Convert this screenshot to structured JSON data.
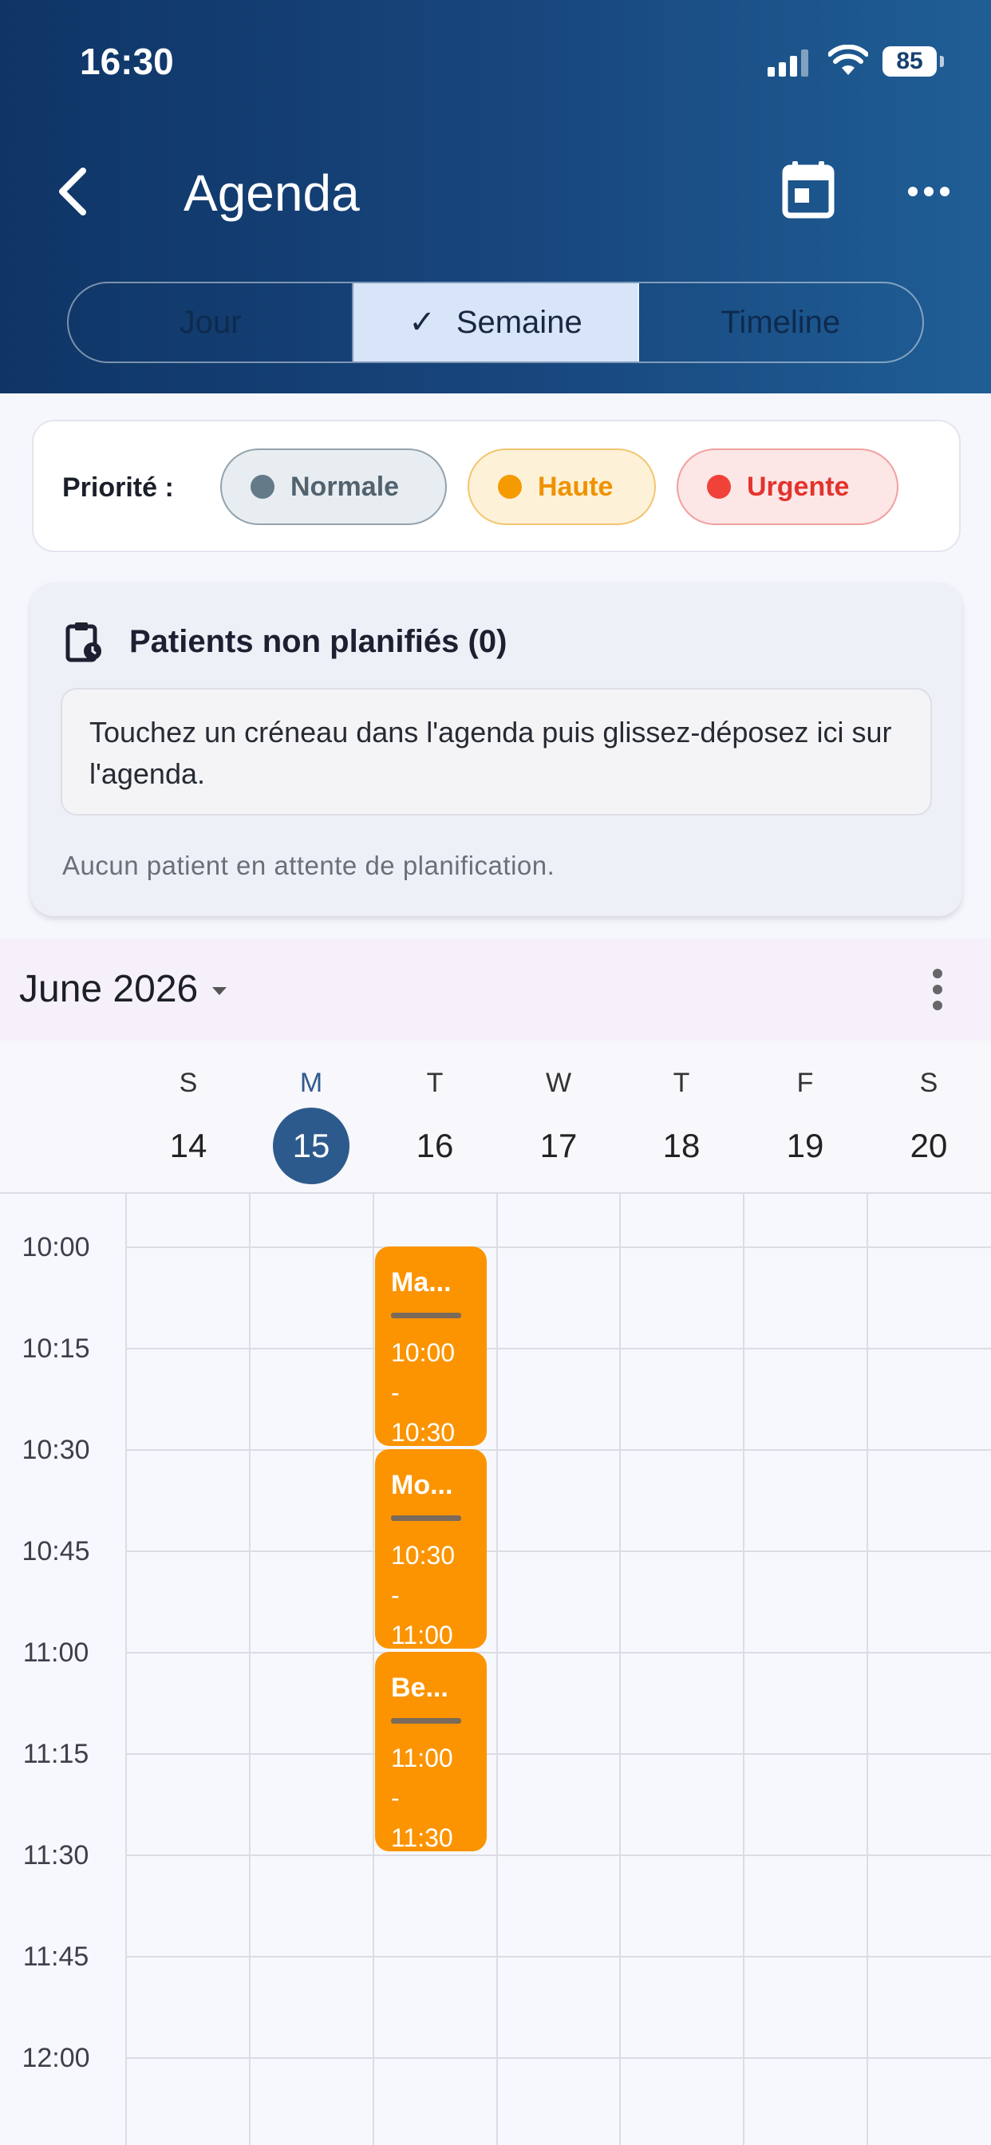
{
  "status_bar": {
    "time": "16:30",
    "battery": "85"
  },
  "header": {
    "title": "Agenda",
    "tabs": [
      {
        "label": "Jour",
        "active": false
      },
      {
        "label": "Semaine",
        "active": true
      },
      {
        "label": "Timeline",
        "active": false
      }
    ]
  },
  "priority": {
    "label": "Priorité :",
    "chips": [
      {
        "label": "Normale",
        "color": "#637a88"
      },
      {
        "label": "Haute",
        "color": "#f59a00"
      },
      {
        "label": "Urgente",
        "color": "#f1423a"
      }
    ]
  },
  "unplanned": {
    "title": "Patients non planifiés (0)",
    "hint": "Touchez un créneau dans l'agenda puis glissez-déposez ici sur l'agenda.",
    "empty": "Aucun patient en attente de planification."
  },
  "calendar": {
    "month": "June 2026",
    "days": [
      {
        "letter": "S",
        "num": "14"
      },
      {
        "letter": "M",
        "num": "15",
        "today": true
      },
      {
        "letter": "T",
        "num": "16"
      },
      {
        "letter": "W",
        "num": "17"
      },
      {
        "letter": "T",
        "num": "18"
      },
      {
        "letter": "F",
        "num": "19"
      },
      {
        "letter": "S",
        "num": "20"
      }
    ],
    "times": [
      "10:00",
      "10:15",
      "10:30",
      "10:45",
      "11:00",
      "11:15",
      "11:30",
      "11:45",
      "12:00"
    ],
    "events": [
      {
        "name": "Ma...",
        "start": "10:00",
        "sep": "-",
        "end": "10:30",
        "color": "#fb9400"
      },
      {
        "name": "Mo...",
        "start": "10:30",
        "sep": "-",
        "end": "11:00",
        "color": "#fb9400"
      },
      {
        "name": "Be...",
        "start": "11:00",
        "sep": "-",
        "end": "11:30",
        "color": "#fb9400"
      }
    ]
  }
}
